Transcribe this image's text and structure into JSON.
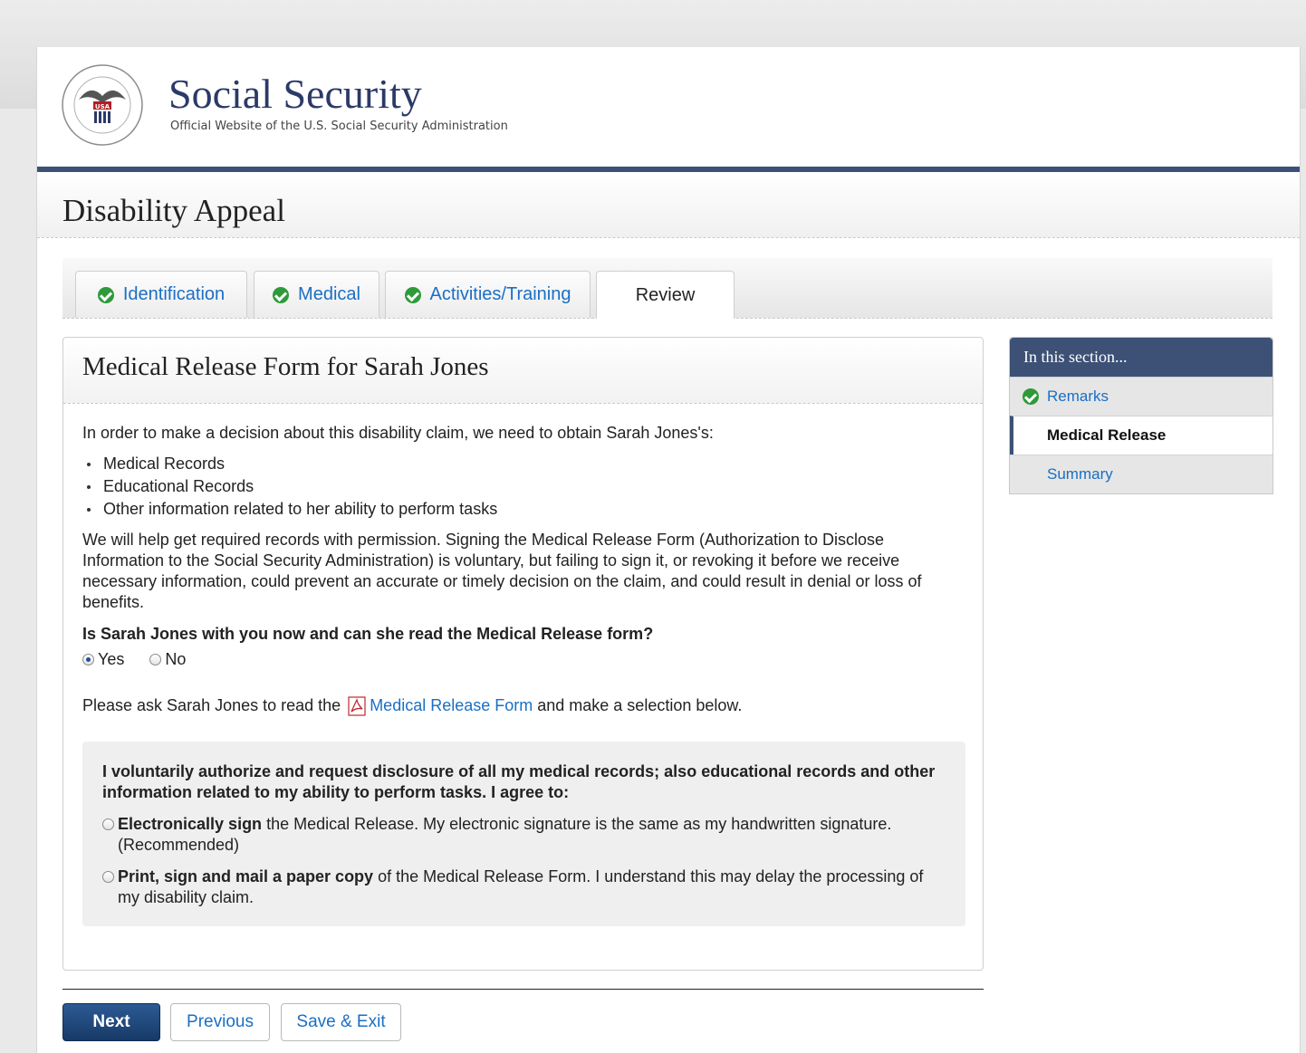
{
  "colors": {
    "accent": "#3d5176",
    "link": "#1a6fc4",
    "complete": "#2e9a3a"
  },
  "header": {
    "title": "Social Security",
    "subtitle": "Official Website of the U.S. Social Security Administration",
    "logo_icon": "ssa-seal-icon"
  },
  "page": {
    "title": "Disability Appeal"
  },
  "tabs": [
    {
      "label": "Identification",
      "complete": true,
      "icon": "check-circle-icon"
    },
    {
      "label": "Medical",
      "complete": true,
      "icon": "check-circle-icon"
    },
    {
      "label": "Activities/Training",
      "complete": true,
      "icon": "check-circle-icon"
    },
    {
      "label": "Review",
      "active": true
    }
  ],
  "main": {
    "title": "Medical Release Form for Sarah Jones",
    "intro": "In order to make a decision about this disability claim, we need to obtain Sarah Jones's:",
    "bullets": [
      "Medical Records",
      "Educational Records",
      "Other information related to her ability to perform tasks"
    ],
    "paragraph": "We will help get required records with permission. Signing the Medical Release Form (Authorization to Disclose Information to the Social Security Administration) is voluntary, but failing to sign it, or revoking it before we receive necessary information, could prevent an accurate or timely decision on the claim, and could result in denial or loss of benefits.",
    "question": "Is Sarah Jones with you now and can she read the Medical Release form?",
    "answer_yes": "Yes",
    "answer_no": "No",
    "selected_answer": "Yes",
    "ask_prefix": "Please ask Sarah Jones to read the",
    "ask_link": "Medical Release Form",
    "ask_suffix": "and make a selection below.",
    "consent": {
      "heading": "I voluntarily authorize and request disclosure of all my medical records; also educational records and other information related to my ability to perform tasks. I agree to:",
      "option1_bold": "Electronically sign",
      "option1_rest": "the Medical Release. My electronic signature is the same as my handwritten signature. (Recommended)",
      "option2_bold": "Print, sign and mail a paper copy",
      "option2_rest": "of the Medical Release Form. I understand this may delay the processing of my disability claim."
    }
  },
  "buttons": {
    "next": "Next",
    "previous": "Previous",
    "save_exit": "Save & Exit"
  },
  "sidebar": {
    "heading": "In this section...",
    "items": [
      {
        "label": "Remarks",
        "complete": true
      },
      {
        "label": "Medical Release",
        "current": true
      },
      {
        "label": "Summary"
      }
    ]
  }
}
